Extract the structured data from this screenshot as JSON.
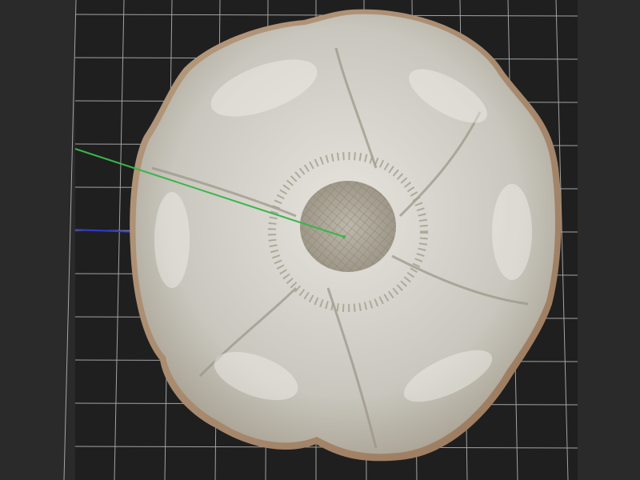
{
  "viewport": {
    "background_color": "#1f1f1f",
    "grid_color": "#cfcfcf",
    "grid_visible": true,
    "x_axis_color": "#39b54a",
    "z_axis_color": "#2f3bd6",
    "object": {
      "name": "flower-relief",
      "petal_count": 6,
      "base_color": "#c9c7be",
      "shadow_color": "#8a8578",
      "highlight_color": "#ecebe6"
    }
  }
}
